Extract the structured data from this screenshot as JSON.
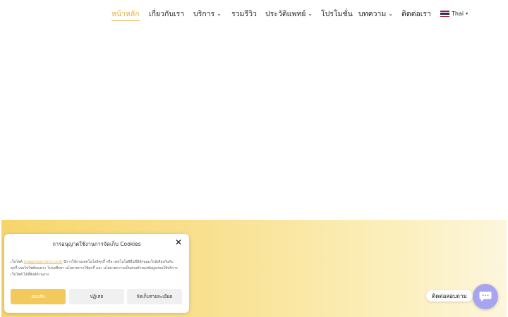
{
  "nav": {
    "items": [
      {
        "label": "หน้าหลัก",
        "active": true,
        "dropdown": false
      },
      {
        "label": "เกี่ยวกับเรา",
        "active": false,
        "dropdown": false
      },
      {
        "label": "บริการ",
        "active": false,
        "dropdown": true
      },
      {
        "label": "รวมรีวิว",
        "active": false,
        "dropdown": false
      },
      {
        "label": "ประวัติแพทย์",
        "active": false,
        "dropdown": true
      },
      {
        "label": "โปรโมชั่น",
        "active": false,
        "dropdown": false
      },
      {
        "label": "บทความ",
        "active": false,
        "dropdown": true
      },
      {
        "label": "ติดต่อเรา",
        "active": false,
        "dropdown": false
      }
    ],
    "language": "Thai",
    "language_flag_icon": "thailand-flag-icon",
    "chevron_icon": "chevron-down-icon"
  },
  "colors": {
    "accent": "#e8b03a",
    "band_start": "#f6d66b",
    "band_end": "#fdf6dc",
    "accept_button": "#f2c95a",
    "chat_button": "#a8a5f0"
  },
  "cookie": {
    "title": "การอนุญาตใช้งานการจัดเก็บ Cookies",
    "body_prefix": "เว็บไซต์ ",
    "body_link": "chaopraya-clinic.co.th",
    "body_suffix": " มีการใช้งานเทคโนโลยีคุกกี้ หรือ เทคโนโลยีอื่นที่มีลักษณะใกล้เคียงกันกับคุกกี้ บนเว็บไซต์ของเรา โปรดศึกษา นโยบายการใช้คุกกี้ และ นโยบายความเป็นส่วนตัวของข้อมูลก่อนใช้บริการเว็บไซต์ ได้ที่ลิงค์ด้านล่าง",
    "accept_label": "ยอมรับ",
    "deny_label": "ปฏิเสธ",
    "preferences_label": "จัดเก็บรายละเอียด",
    "close_icon": "close-icon"
  },
  "chat": {
    "label": "ติดต่อสอบถาม",
    "icon": "chat-bubble-icon"
  }
}
